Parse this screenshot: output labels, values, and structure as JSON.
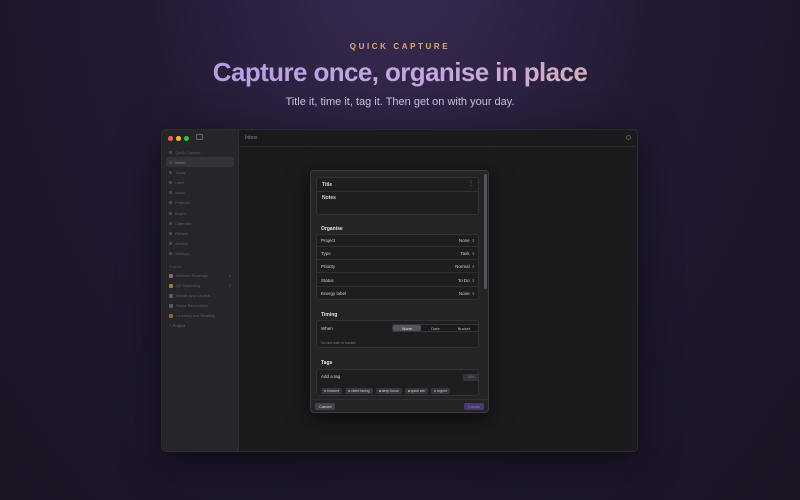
{
  "hero": {
    "eyebrow": "QUICK CAPTURE",
    "headline": "Capture once, organise in place",
    "subline": "Title it, time it, tag it. Then get on with your day."
  },
  "window": {
    "sidebar": {
      "items": [
        {
          "label": "Quick Capture"
        },
        {
          "label": "Inbox",
          "active": true
        },
        {
          "label": "Today"
        },
        {
          "label": "Later"
        },
        {
          "label": "Inbox"
        },
        {
          "label": "Projects"
        },
        {
          "label": "Board"
        },
        {
          "label": "Calendar"
        },
        {
          "label": "Review"
        },
        {
          "label": "Archive"
        },
        {
          "label": "Settings"
        }
      ],
      "projects_label": "Projects",
      "projects": [
        {
          "label": "Website Redesign",
          "count": "4",
          "color": "#8a6a5a"
        },
        {
          "label": "Q3 Marketing",
          "count": "2",
          "color": "#a0763a"
        },
        {
          "label": "Mobile App Launch",
          "count": "",
          "color": "#5a5a60"
        },
        {
          "label": "Home Renovation",
          "count": "",
          "color": "#5a5a60"
        },
        {
          "label": "Learning and Reading",
          "count": "",
          "color": "#8a6a3a"
        }
      ],
      "new_project": "+ Project"
    },
    "header": {
      "title": "Inbox"
    }
  },
  "modal": {
    "title_label": "Title",
    "notes_label": "Notes",
    "organise": {
      "heading": "Organise",
      "rows": [
        {
          "key": "Project",
          "value": "None"
        },
        {
          "key": "Type",
          "value": "Task"
        },
        {
          "key": "Priority",
          "value": "Normal"
        },
        {
          "key": "Status",
          "value": "To Do"
        },
        {
          "key": "Energy label",
          "value": "None"
        }
      ]
    },
    "timing": {
      "heading": "Timing",
      "when_label": "When",
      "options": [
        "None",
        "Date",
        "Bucket"
      ],
      "selected": "None",
      "hint": "No due date or bucket"
    },
    "tags": {
      "heading": "Tags",
      "add_label": "Add a tag",
      "add_button": "Add",
      "items": [
        {
          "label": "blocked",
          "color": "#d07a6a"
        },
        {
          "label": "client facing",
          "color": "#6aa8d0"
        },
        {
          "label": "deep focus",
          "color": "#8ad07a"
        },
        {
          "label": "quick win",
          "color": "#d0b06a"
        },
        {
          "label": "urgent",
          "color": "#e06060"
        }
      ]
    },
    "footer": {
      "cancel": "Cancel",
      "create": "Create"
    }
  }
}
